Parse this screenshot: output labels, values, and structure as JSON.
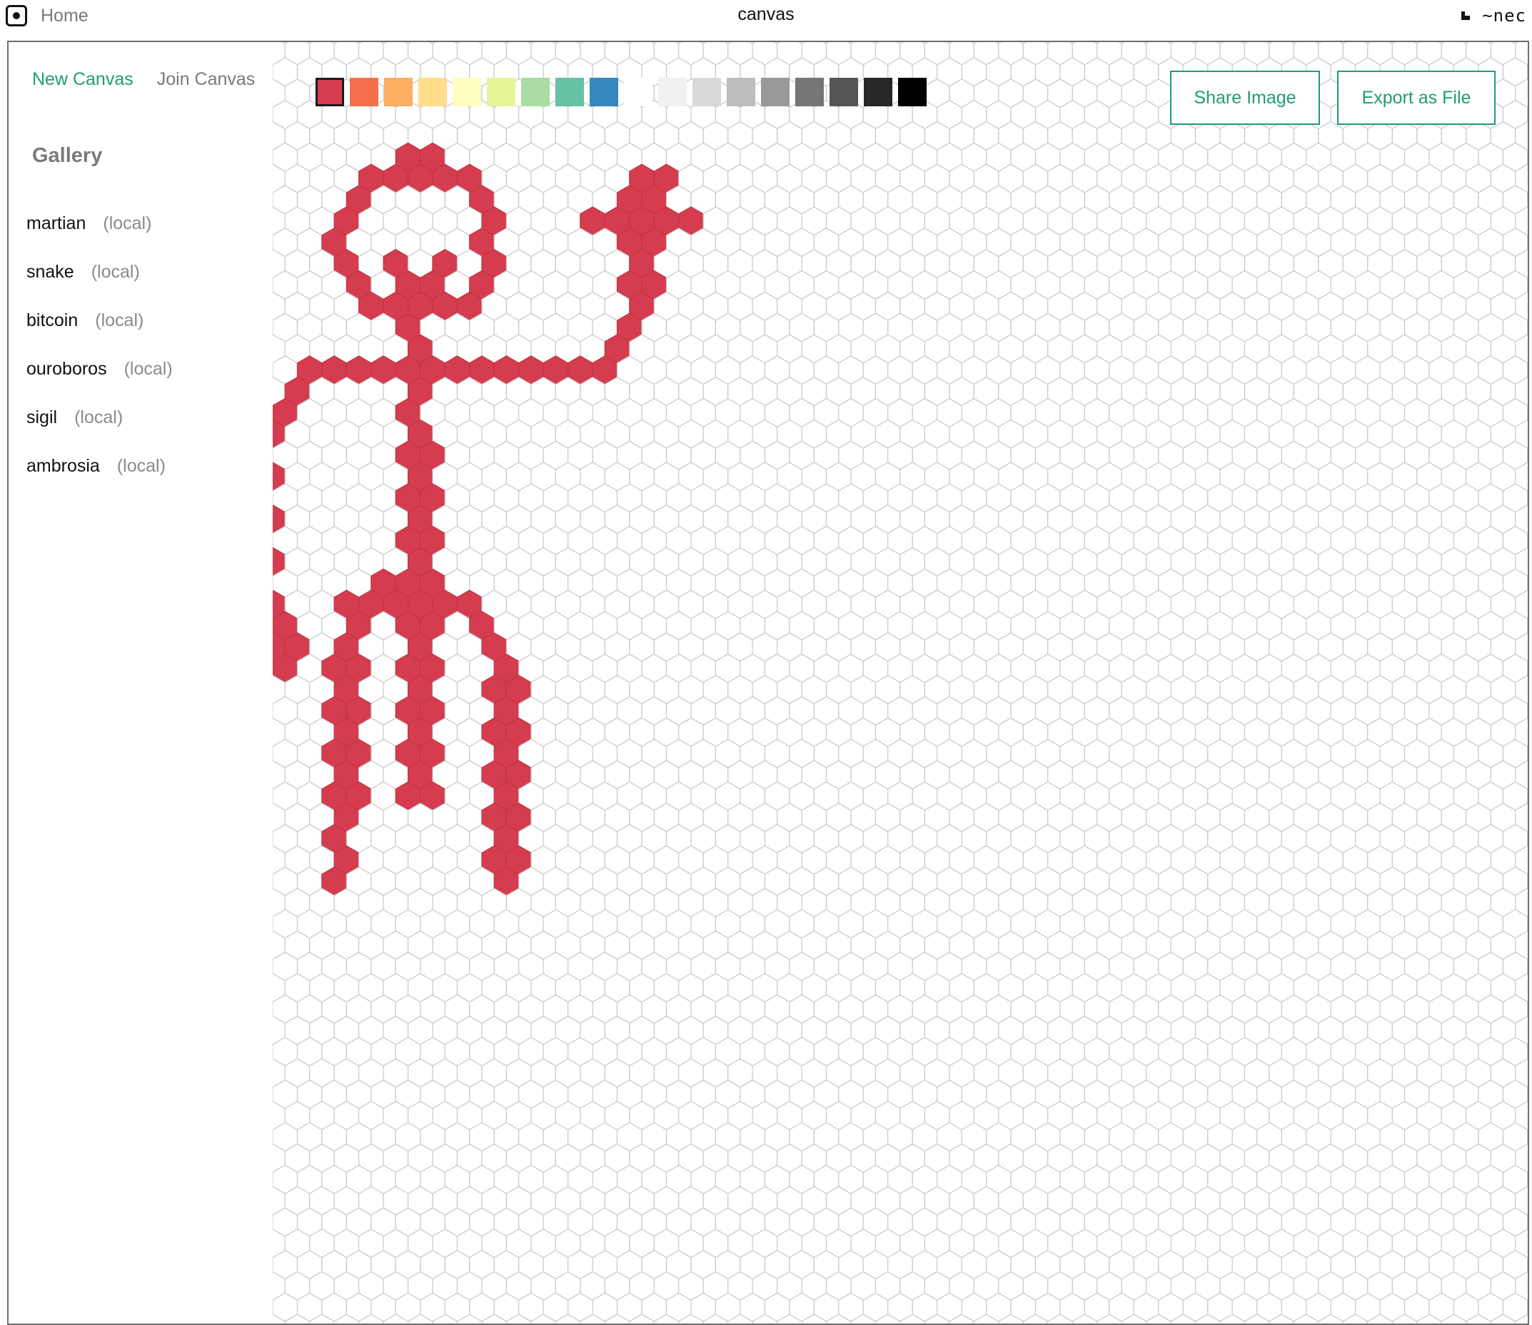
{
  "header": {
    "home_label": "Home",
    "title": "canvas",
    "user": "~nec",
    "icons": {
      "home": "app-home-icon",
      "user": "sigil-icon"
    }
  },
  "sidebar": {
    "tabs": [
      {
        "label": "New Canvas",
        "active": true
      },
      {
        "label": "Join Canvas",
        "active": false
      }
    ],
    "gallery_heading": "Gallery",
    "gallery": [
      {
        "name": "martian",
        "tag": "(local)"
      },
      {
        "name": "snake",
        "tag": "(local)"
      },
      {
        "name": "bitcoin",
        "tag": "(local)"
      },
      {
        "name": "ouroboros",
        "tag": "(local)"
      },
      {
        "name": "sigil",
        "tag": "(local)"
      },
      {
        "name": "ambrosia",
        "tag": "(local)"
      }
    ]
  },
  "palette": {
    "colors": [
      "#d63c4f",
      "#f4704c",
      "#fcae61",
      "#fedd8c",
      "#feffbe",
      "#e5f597",
      "#abdca3",
      "#66c1a5",
      "#3488bd",
      "#ffffff",
      "#f1f1f1",
      "#d9d9d9",
      "#bdbdbd",
      "#999999",
      "#767676",
      "#555555",
      "#272727",
      "#000000"
    ],
    "selected_index": 0
  },
  "toolbar": {
    "share_label": "Share Image",
    "export_label": "Export as File"
  },
  "canvas": {
    "fill_color": "#d63c4f",
    "grid_stroke_color": "#c9c9c9",
    "background_color": "#ffffff"
  }
}
